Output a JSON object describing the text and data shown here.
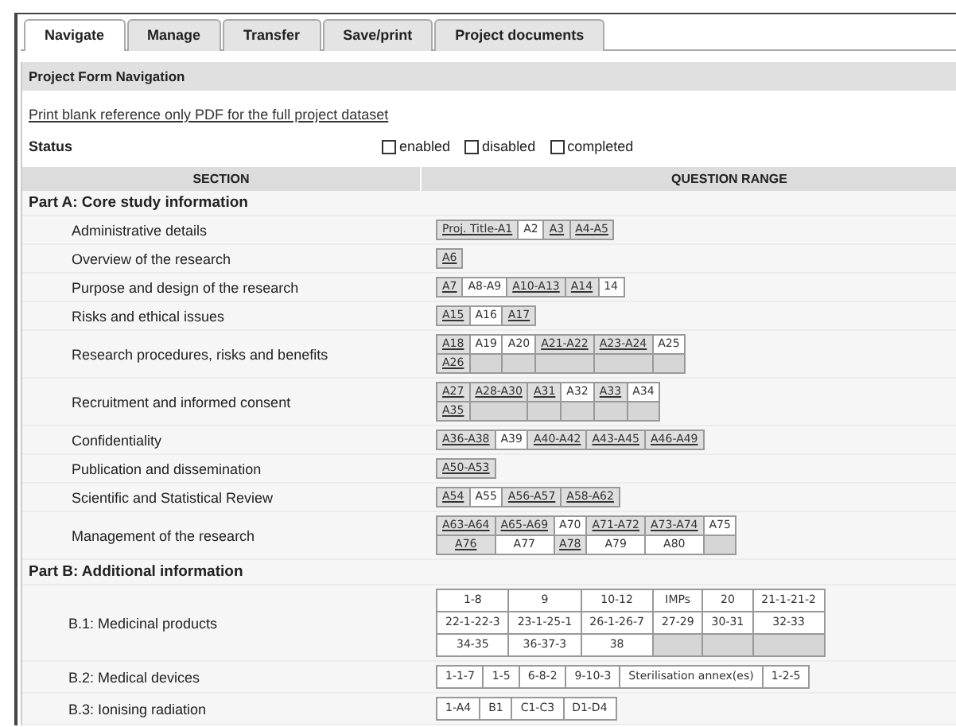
{
  "tabs": [
    {
      "label": "Navigate",
      "selected": true
    },
    {
      "label": "Manage",
      "selected": false
    },
    {
      "label": "Transfer",
      "selected": false
    },
    {
      "label": "Save/print",
      "selected": false
    },
    {
      "label": "Project documents",
      "selected": false
    }
  ],
  "panel_title": "Project Form Navigation",
  "print_link": "Print blank reference only PDF for the full project dataset",
  "status": {
    "label": "Status",
    "legend": [
      {
        "label": "enabled",
        "checked": false
      },
      {
        "label": "disabled",
        "checked": false
      },
      {
        "label": "completed",
        "checked": false
      }
    ]
  },
  "columns": [
    "SECTION",
    "QUESTION RANGE"
  ],
  "groups": [
    {
      "title": "Part A: Core study information",
      "sections": [
        {
          "name": "Administrative details",
          "rows": [
            [
              {
                "kind": "link",
                "text": "Proj. Title-A1"
              },
              {
                "kind": "plain",
                "text": "A2"
              },
              {
                "kind": "link",
                "text": "A3"
              },
              {
                "kind": "link",
                "text": "A4-A5"
              }
            ]
          ]
        },
        {
          "name": "Overview of the research",
          "rows": [
            [
              {
                "kind": "link",
                "text": "A6"
              }
            ]
          ]
        },
        {
          "name": "Purpose and design of the research",
          "rows": [
            [
              {
                "kind": "link",
                "text": "A7"
              },
              {
                "kind": "plain",
                "text": "A8-A9"
              },
              {
                "kind": "link",
                "text": "A10-A13"
              },
              {
                "kind": "link",
                "text": "A14"
              },
              {
                "kind": "plain",
                "text": "14"
              }
            ]
          ]
        },
        {
          "name": "Risks and ethical issues",
          "rows": [
            [
              {
                "kind": "link",
                "text": "A15"
              },
              {
                "kind": "plain",
                "text": "A16"
              },
              {
                "kind": "link",
                "text": "A17"
              }
            ]
          ]
        },
        {
          "name": "Research procedures, risks and benefits",
          "rows": [
            [
              {
                "kind": "link",
                "text": "A18"
              },
              {
                "kind": "plain",
                "text": "A19"
              },
              {
                "kind": "plain",
                "text": "A20"
              },
              {
                "kind": "link",
                "text": "A21-A22"
              },
              {
                "kind": "link",
                "text": "A23-A24"
              },
              {
                "kind": "plain",
                "text": "A25"
              }
            ],
            [
              {
                "kind": "link",
                "text": "A26"
              },
              {
                "kind": "blank"
              },
              {
                "kind": "blank"
              },
              {
                "kind": "blank"
              },
              {
                "kind": "blank"
              },
              {
                "kind": "blank"
              }
            ]
          ]
        },
        {
          "name": "Recruitment and informed consent",
          "rows": [
            [
              {
                "kind": "link",
                "text": "A27"
              },
              {
                "kind": "link",
                "text": "A28-A30"
              },
              {
                "kind": "link",
                "text": "A31"
              },
              {
                "kind": "plain",
                "text": "A32"
              },
              {
                "kind": "link",
                "text": "A33"
              },
              {
                "kind": "plain",
                "text": "A34"
              }
            ],
            [
              {
                "kind": "link",
                "text": "A35"
              },
              {
                "kind": "blank"
              },
              {
                "kind": "blank"
              },
              {
                "kind": "blank"
              },
              {
                "kind": "blank"
              },
              {
                "kind": "blank"
              }
            ]
          ]
        },
        {
          "name": "Confidentiality",
          "rows": [
            [
              {
                "kind": "link",
                "text": "A36-A38"
              },
              {
                "kind": "plain",
                "text": "A39"
              },
              {
                "kind": "link",
                "text": "A40-A42"
              },
              {
                "kind": "link",
                "text": "A43-A45"
              },
              {
                "kind": "link",
                "text": "A46-A49"
              }
            ]
          ]
        },
        {
          "name": "Publication and dissemination",
          "rows": [
            [
              {
                "kind": "link",
                "text": "A50-A53"
              }
            ]
          ]
        },
        {
          "name": "Scientific and Statistical Review",
          "rows": [
            [
              {
                "kind": "link",
                "text": "A54"
              },
              {
                "kind": "plain",
                "text": "A55"
              },
              {
                "kind": "link",
                "text": "A56-A57"
              },
              {
                "kind": "link",
                "text": "A58-A62"
              }
            ]
          ]
        },
        {
          "name": "Management of the research",
          "rows": [
            [
              {
                "kind": "link",
                "text": "A63-A64"
              },
              {
                "kind": "link",
                "text": "A65-A69"
              },
              {
                "kind": "plain",
                "text": "A70"
              },
              {
                "kind": "link",
                "text": "A71-A72"
              },
              {
                "kind": "link",
                "text": "A73-A74"
              },
              {
                "kind": "plain",
                "text": "A75"
              }
            ],
            [
              {
                "kind": "link",
                "text": "A76"
              },
              {
                "kind": "plain",
                "text": "A77"
              },
              {
                "kind": "link",
                "text": "A78"
              },
              {
                "kind": "plain",
                "text": "A79"
              },
              {
                "kind": "plain",
                "text": "A80"
              },
              {
                "kind": "blank"
              }
            ]
          ]
        }
      ]
    },
    {
      "title": "Part B: Additional information",
      "sections": [
        {
          "name": "B.1: Medicinal products",
          "rows": [
            [
              {
                "kind": "plain",
                "text": "1-8"
              },
              {
                "kind": "plain",
                "text": "9"
              },
              {
                "kind": "plain",
                "text": "10-12"
              },
              {
                "kind": "plain",
                "text": "IMPs"
              },
              {
                "kind": "plain",
                "text": "20"
              },
              {
                "kind": "plain",
                "text": "21-1-21-2"
              }
            ],
            [
              {
                "kind": "plain",
                "text": "22-1-22-3"
              },
              {
                "kind": "plain",
                "text": "23-1-25-1"
              },
              {
                "kind": "plain",
                "text": "26-1-26-7"
              },
              {
                "kind": "plain",
                "text": "27-29"
              },
              {
                "kind": "plain",
                "text": "30-31"
              },
              {
                "kind": "plain",
                "text": "32-33"
              }
            ],
            [
              {
                "kind": "plain",
                "text": "34-35"
              },
              {
                "kind": "plain",
                "text": "36-37-3"
              },
              {
                "kind": "plain",
                "text": "38"
              },
              {
                "kind": "blank"
              },
              {
                "kind": "blank"
              },
              {
                "kind": "blank"
              }
            ]
          ]
        },
        {
          "name": "B.2: Medical devices",
          "rows": [
            [
              {
                "kind": "plain",
                "text": "1-1-7"
              },
              {
                "kind": "plain",
                "text": "1-5"
              },
              {
                "kind": "plain",
                "text": "6-8-2"
              },
              {
                "kind": "plain",
                "text": "9-10-3"
              },
              {
                "kind": "plain",
                "text": "Sterilisation annex(es)"
              },
              {
                "kind": "plain",
                "text": "1-2-5"
              }
            ]
          ]
        },
        {
          "name": "B.3: Ionising radiation",
          "rows": [
            [
              {
                "kind": "plain",
                "text": "1-A4"
              },
              {
                "kind": "plain",
                "text": "B1"
              },
              {
                "kind": "plain",
                "text": "C1-C3"
              },
              {
                "kind": "plain",
                "text": "D1-D4"
              }
            ]
          ]
        }
      ]
    }
  ]
}
